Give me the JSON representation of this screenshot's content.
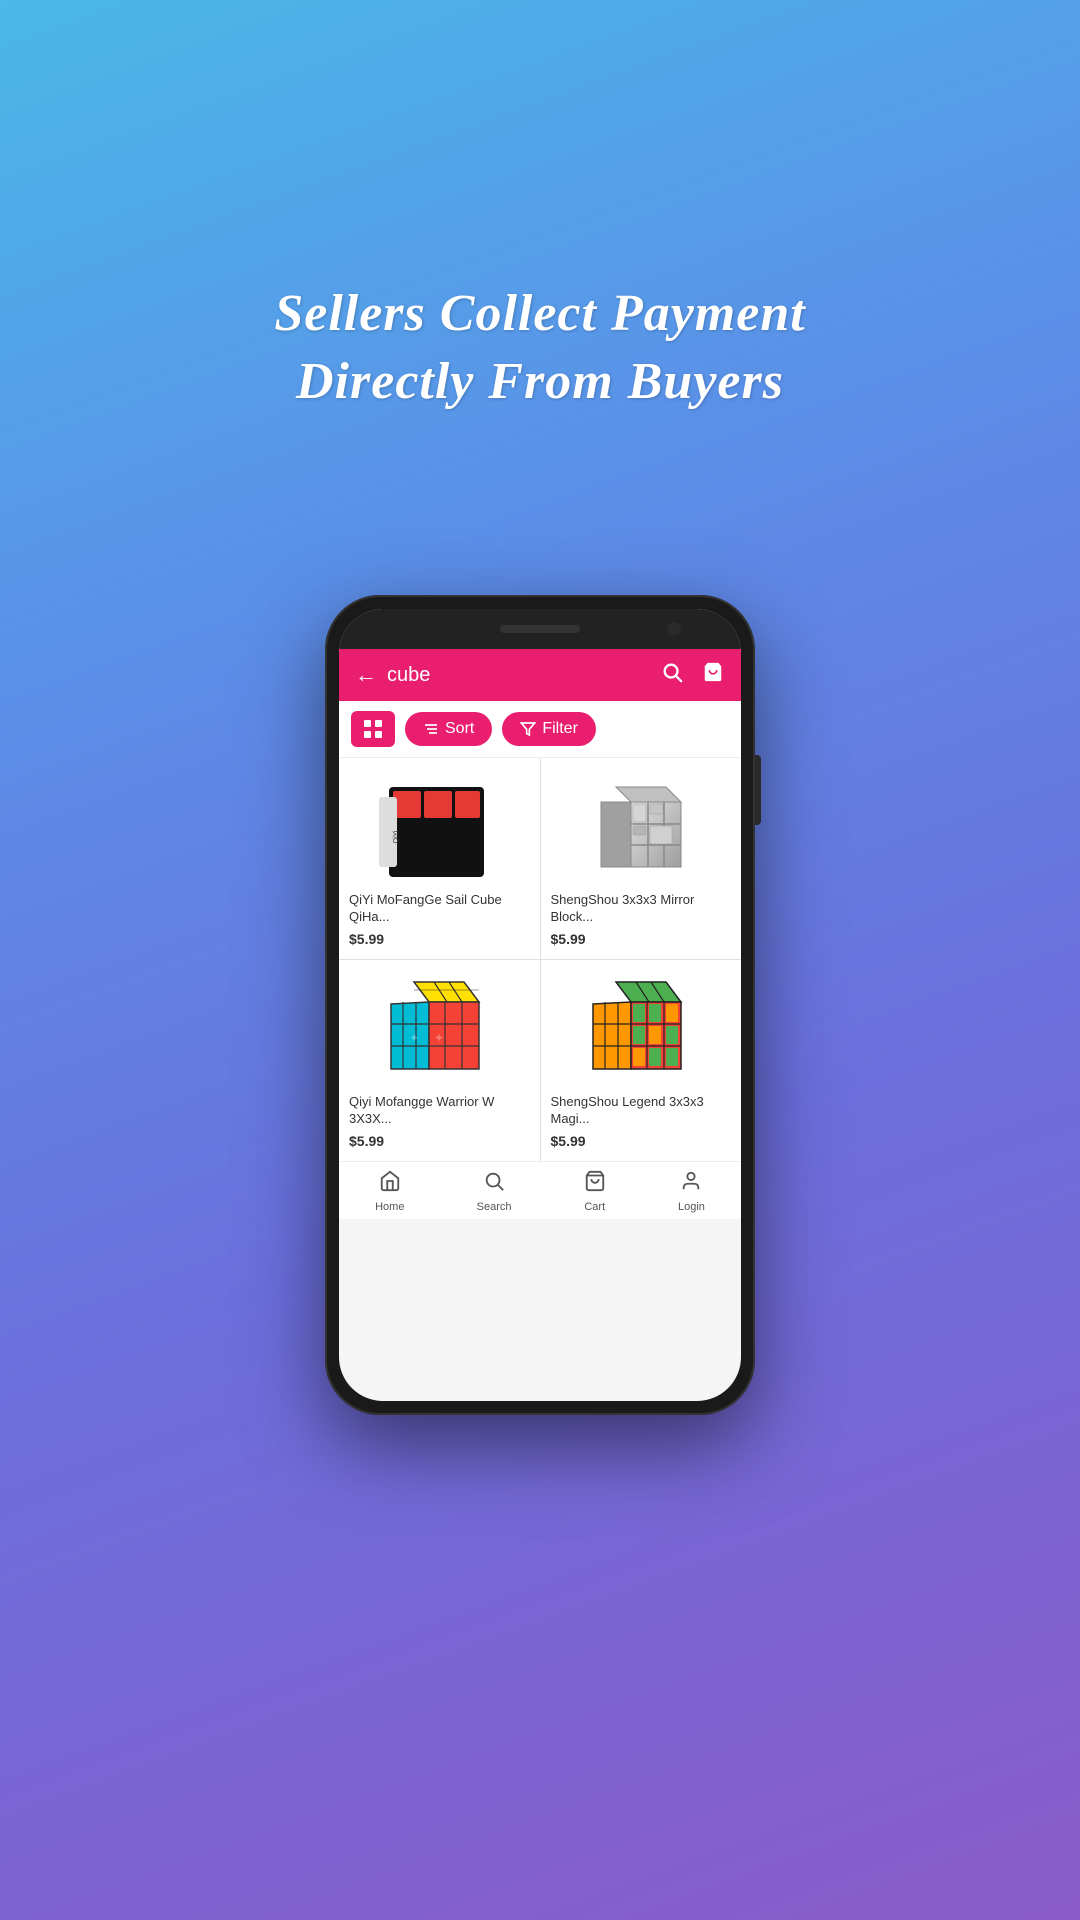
{
  "hero": {
    "line1": "Sellers Collect Payment",
    "line2": "Directly From Buyers"
  },
  "app": {
    "header": {
      "search_query": "cube",
      "search_icon": "🔍",
      "cart_icon": "🛒",
      "back_icon": "←"
    },
    "filter_bar": {
      "sort_label": "Sort",
      "filter_label": "Filter"
    },
    "products": [
      {
        "name": "QiYi MoFangGe Sail Cube QiHa...",
        "price": "$5.99",
        "type": "color-cube"
      },
      {
        "name": "ShengShou 3x3x3 Mirror Block...",
        "price": "$5.99",
        "type": "mirror-cube"
      },
      {
        "name": "Qiyi Mofangge Warrior W 3X3X...",
        "price": "$5.99",
        "type": "stickerless-cube"
      },
      {
        "name": "ShengShou Legend 3x3x3 Magi...",
        "price": "$5.99",
        "type": "green-cube"
      }
    ],
    "bottom_nav": [
      {
        "label": "Home",
        "icon": "⌂"
      },
      {
        "label": "Search",
        "icon": "🔍"
      },
      {
        "label": "Cart",
        "icon": "🛒"
      },
      {
        "label": "Login",
        "icon": "👤"
      }
    ]
  }
}
